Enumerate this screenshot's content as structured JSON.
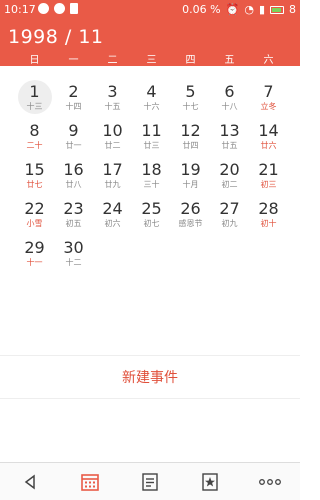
{
  "status_bar": {
    "time": "10:17",
    "battery_percent": "0.06 %",
    "battery_number": "8"
  },
  "header": {
    "month_title": "1998 / 11",
    "weekdays": [
      "日",
      "一",
      "二",
      "三",
      "四",
      "五",
      "六"
    ]
  },
  "calendar": {
    "weeks": [
      [
        {
          "d": "1",
          "l": "十三",
          "red": false,
          "selected": true
        },
        {
          "d": "2",
          "l": "十四",
          "red": false
        },
        {
          "d": "3",
          "l": "十五",
          "red": false
        },
        {
          "d": "4",
          "l": "十六",
          "red": false
        },
        {
          "d": "5",
          "l": "十七",
          "red": false
        },
        {
          "d": "6",
          "l": "十八",
          "red": false
        },
        {
          "d": "7",
          "l": "立冬",
          "red": true
        }
      ],
      [
        {
          "d": "8",
          "l": "二十",
          "red": true
        },
        {
          "d": "9",
          "l": "廿一",
          "red": false
        },
        {
          "d": "10",
          "l": "廿二",
          "red": false
        },
        {
          "d": "11",
          "l": "廿三",
          "red": false
        },
        {
          "d": "12",
          "l": "廿四",
          "red": false
        },
        {
          "d": "13",
          "l": "廿五",
          "red": false
        },
        {
          "d": "14",
          "l": "廿六",
          "red": true
        }
      ],
      [
        {
          "d": "15",
          "l": "廿七",
          "red": true
        },
        {
          "d": "16",
          "l": "廿八",
          "red": false
        },
        {
          "d": "17",
          "l": "廿九",
          "red": false
        },
        {
          "d": "18",
          "l": "三十",
          "red": false
        },
        {
          "d": "19",
          "l": "十月",
          "red": false
        },
        {
          "d": "20",
          "l": "初二",
          "red": false
        },
        {
          "d": "21",
          "l": "初三",
          "red": true
        }
      ],
      [
        {
          "d": "22",
          "l": "小雪",
          "red": true
        },
        {
          "d": "23",
          "l": "初五",
          "red": false
        },
        {
          "d": "24",
          "l": "初六",
          "red": false
        },
        {
          "d": "25",
          "l": "初七",
          "red": false
        },
        {
          "d": "26",
          "l": "感恩节",
          "red": false
        },
        {
          "d": "27",
          "l": "初九",
          "red": false
        },
        {
          "d": "28",
          "l": "初十",
          "red": true
        }
      ],
      [
        {
          "d": "29",
          "l": "十一",
          "red": true
        },
        {
          "d": "30",
          "l": "十二",
          "red": false
        }
      ]
    ]
  },
  "actions": {
    "new_event": "新建事件"
  },
  "bottom_bar": {
    "icons": [
      "back-icon",
      "calendar-icon",
      "list-icon",
      "star-icon",
      "more-icon"
    ]
  },
  "colors": {
    "accent": "#e95a47",
    "holiday_text": "#e0503b"
  }
}
